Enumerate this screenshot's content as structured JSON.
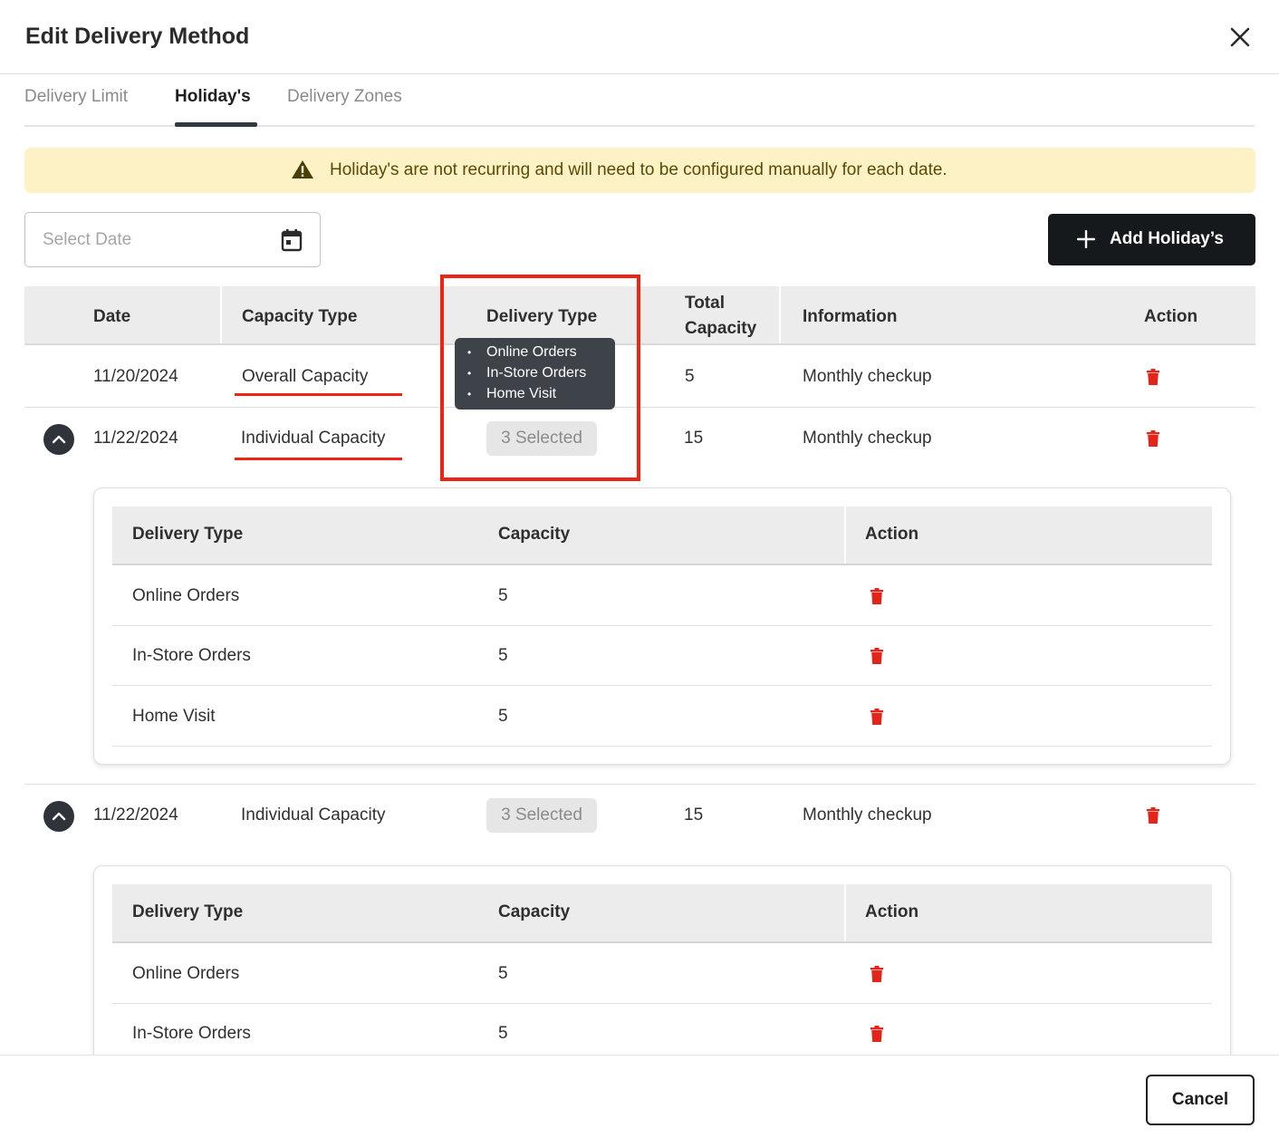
{
  "modal": {
    "title": "Edit Delivery Method"
  },
  "tabs": [
    {
      "label": "Delivery Limit",
      "active": false
    },
    {
      "label": "Holiday's",
      "active": true
    },
    {
      "label": "Delivery Zones",
      "active": false
    }
  ],
  "alert": {
    "text": "Holiday's are not recurring and will need to be configured manually for each date.",
    "icon": "warning-icon"
  },
  "filter": {
    "date_placeholder": "Select Date",
    "calendar_icon": "calendar-icon"
  },
  "add_button": {
    "label": "Add Holiday’s",
    "icon": "plus-icon"
  },
  "table": {
    "headers": {
      "date": "Date",
      "capacity_type": "Capacity Type",
      "delivery_type": "Delivery Type",
      "total_capacity_line1": "Total",
      "total_capacity_line2": "Capacity",
      "information": "Information",
      "action": "Action"
    },
    "rows": [
      {
        "date": "11/20/2024",
        "capacity_type": "Overall Capacity",
        "delivery_type": "",
        "total_capacity": "5",
        "information": "Monthly checkup",
        "expandable": false
      },
      {
        "date": "11/22/2024",
        "capacity_type": "Individual Capacity",
        "delivery_type": "3 Selected",
        "total_capacity": "15",
        "information": "Monthly checkup",
        "expandable": true,
        "expanded": true
      },
      {
        "date": "11/22/2024",
        "capacity_type": "Individual Capacity",
        "delivery_type": "3 Selected",
        "total_capacity": "15",
        "information": "Monthly checkup",
        "expandable": true,
        "expanded": true
      }
    ]
  },
  "tooltip": {
    "items": [
      "Online Orders",
      "In-Store Orders",
      "Home Visit"
    ]
  },
  "subtable": {
    "headers": {
      "delivery_type": "Delivery Type",
      "capacity": "Capacity",
      "action": "Action"
    },
    "first": [
      {
        "delivery_type": "Online Orders",
        "capacity": "5"
      },
      {
        "delivery_type": "In-Store Orders",
        "capacity": "5"
      },
      {
        "delivery_type": "Home Visit",
        "capacity": "5"
      }
    ],
    "second": [
      {
        "delivery_type": "Online Orders",
        "capacity": "5"
      },
      {
        "delivery_type": "In-Store Orders",
        "capacity": "5"
      }
    ]
  },
  "footer": {
    "cancel_label": "Cancel"
  },
  "colors": {
    "accent": "#16191b",
    "danger": "#e3241b",
    "alert_bg": "#fcf2c5",
    "annotation": "#ee2513"
  }
}
